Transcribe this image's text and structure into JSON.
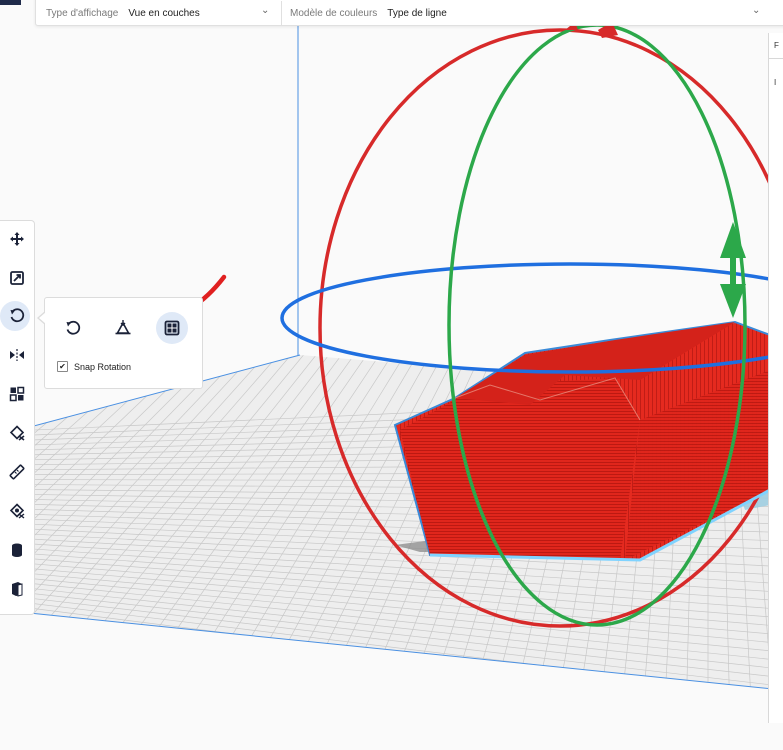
{
  "header": {
    "view_type_label": "Type d'affichage",
    "view_type_value": "Vue en couches",
    "color_model_label": "Modèle de couleurs",
    "color_model_value": "Type de ligne"
  },
  "right_panel": {
    "tab_letter": "F",
    "item_letter": "I"
  },
  "toolbar": {
    "tools": [
      {
        "name": "move-tool",
        "icon": "move-icon"
      },
      {
        "name": "scale-tool",
        "icon": "scale-icon"
      },
      {
        "name": "rotate-tool",
        "icon": "rotate-icon",
        "active": true
      },
      {
        "name": "mirror-tool",
        "icon": "mirror-icon"
      },
      {
        "name": "per-model-settings-tool",
        "icon": "per-model-settings-icon"
      },
      {
        "name": "support-blocker-tool",
        "icon": "support-blocker-icon"
      },
      {
        "name": "measure-tool",
        "icon": "ruler-icon"
      },
      {
        "name": "custom-supports-tool",
        "icon": "custom-supports-icon"
      },
      {
        "name": "cylinder-tool",
        "icon": "cylinder-icon"
      },
      {
        "name": "cube-tool",
        "icon": "cube-icon"
      }
    ]
  },
  "rotate_popup": {
    "buttons": [
      {
        "name": "reset-rotation",
        "icon": "reset-rotation-icon"
      },
      {
        "name": "lay-flat",
        "icon": "lay-flat-icon"
      },
      {
        "name": "select-face-to-align",
        "icon": "align-face-icon",
        "active": true
      }
    ],
    "snap_label": "Snap Rotation",
    "snap_checked": true
  },
  "colors": {
    "model": "#e1251b",
    "ring_red": "#d72a2a",
    "ring_green": "#2ca84a",
    "ring_blue": "#1f6fe0",
    "annotation_arrow": "#e02020",
    "accent": "#dfe9f7"
  }
}
